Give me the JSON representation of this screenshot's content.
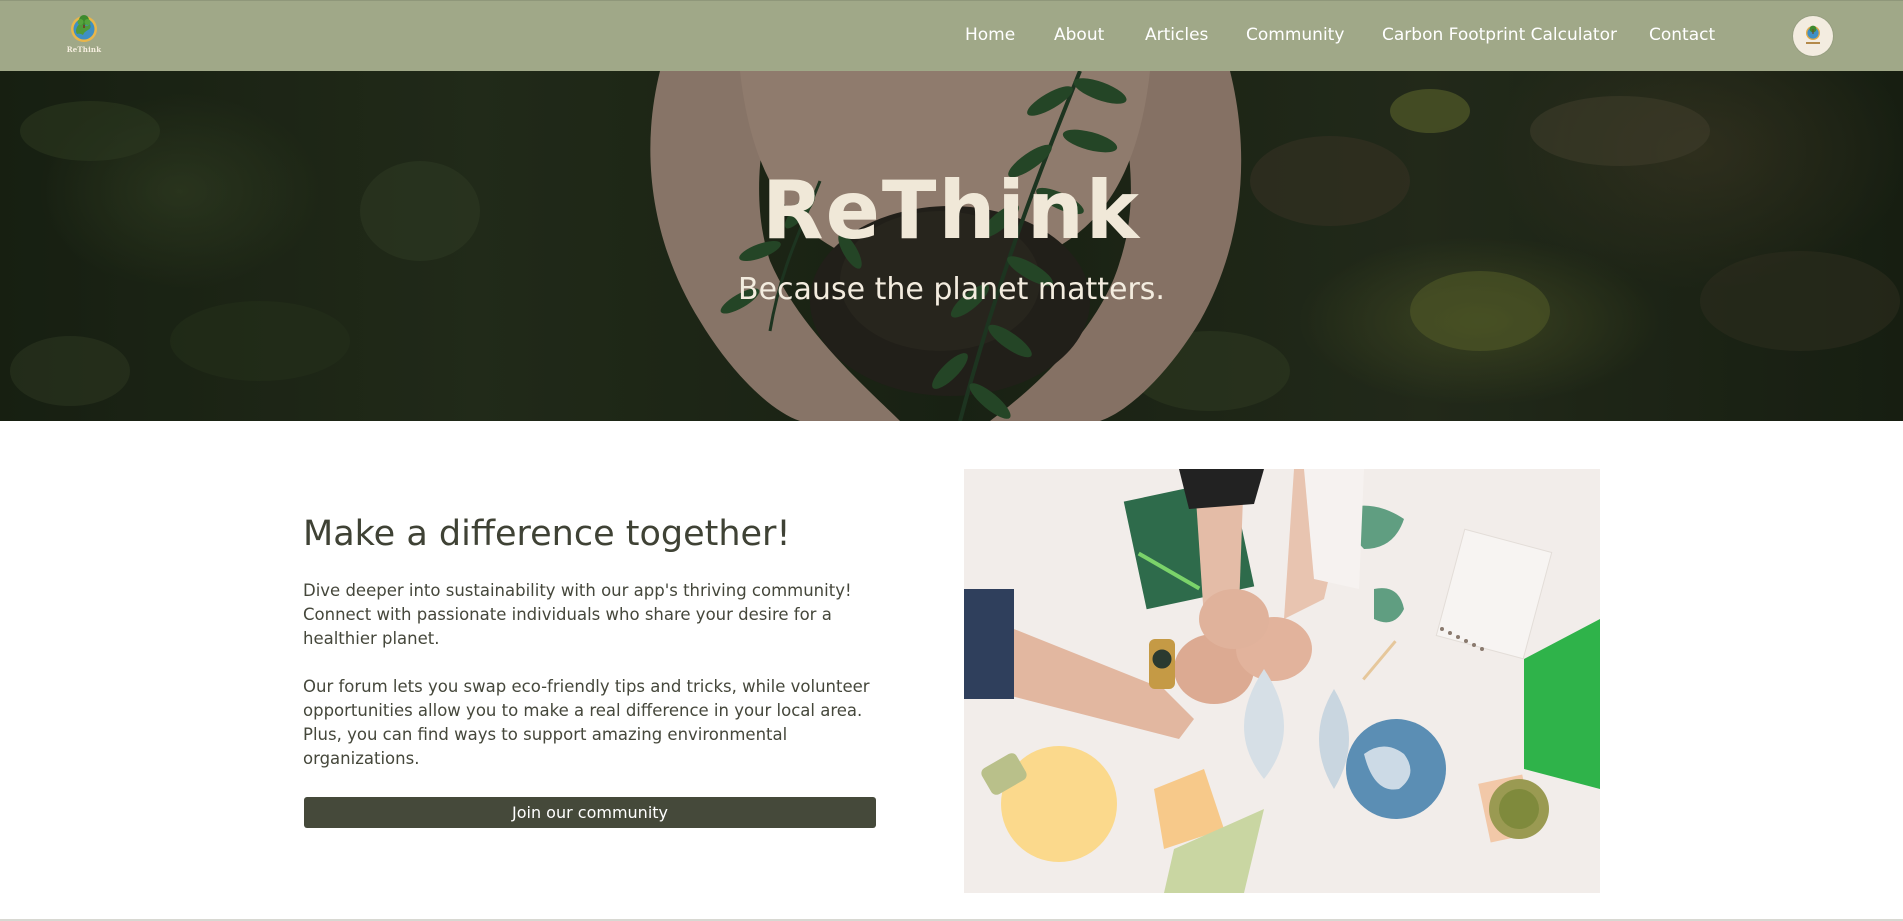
{
  "brand": {
    "logo_icon": "globe-tree-logo",
    "logo_text": "ReThink"
  },
  "nav": {
    "items": [
      {
        "label": "Home"
      },
      {
        "label": "About"
      },
      {
        "label": "Articles"
      },
      {
        "label": "Community"
      },
      {
        "label": "Carbon Footprint Calculator"
      },
      {
        "label": "Contact"
      }
    ],
    "avatar_icon": "user-avatar-logo"
  },
  "hero": {
    "title": "ReThink",
    "subtitle": "Because the planet matters.",
    "image": "hands-holding-soil-with-plant"
  },
  "community": {
    "heading": "Make a difference together!",
    "paragraph1": "Dive deeper into sustainability with our app's thriving community! Connect with passionate individuals who share your desire for a healthier planet.",
    "paragraph2": "Our forum lets you swap eco-friendly tips and tricks, while volunteer opportunities allow you to make a real difference in your local area. Plus, you can find ways to support amazing environmental organizations.",
    "button_label": "Join our community",
    "image": "hands-fist-bump-eco-desk"
  },
  "colors": {
    "navbar": "#a0a888",
    "button": "#45493a",
    "hero_text": "#f0e8d8",
    "body_text": "#45473b"
  }
}
